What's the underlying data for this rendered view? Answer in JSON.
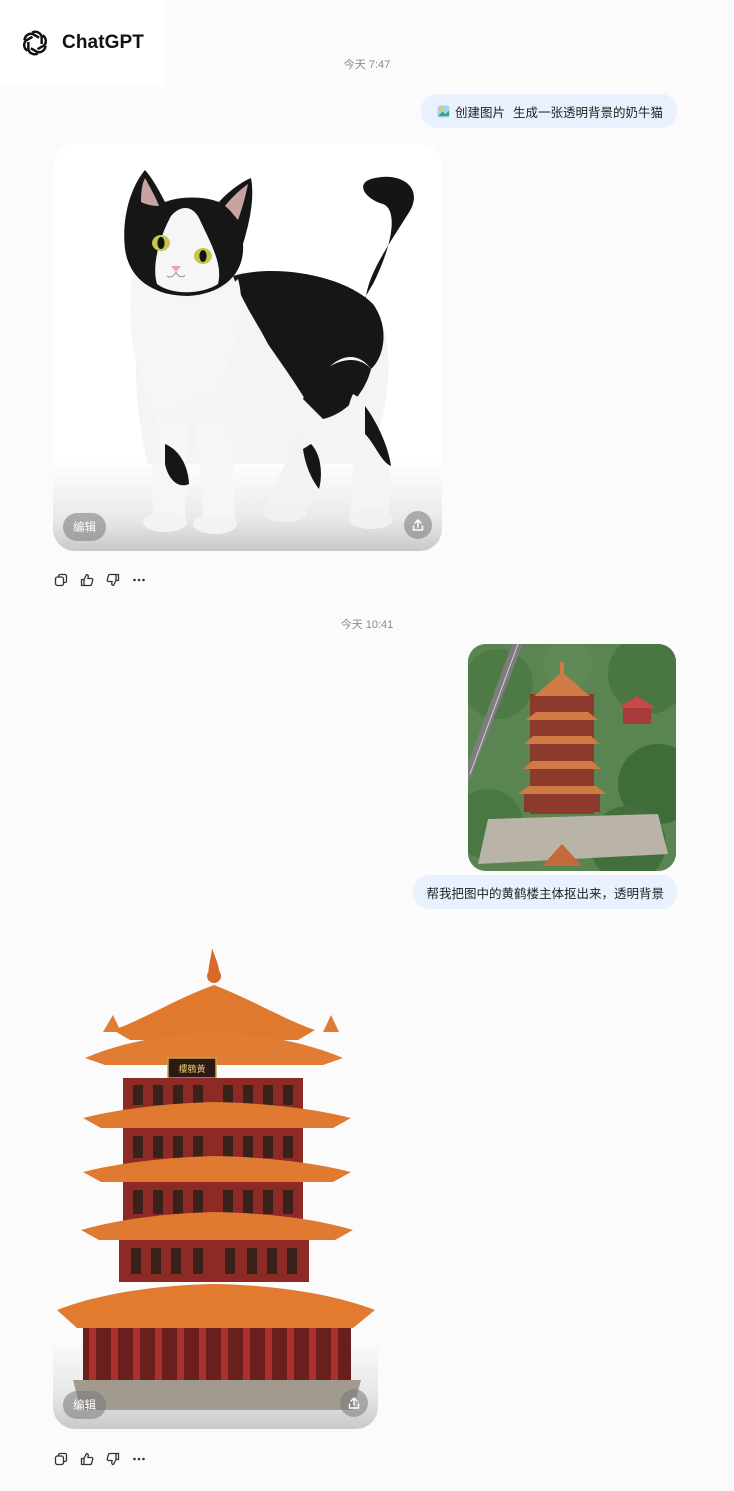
{
  "brand": {
    "name": "ChatGPT",
    "icon": "openai-logo-icon"
  },
  "conversation": {
    "turns": [
      {
        "timestamp": "今天 7:47",
        "user": {
          "tool_icon": "image-create-icon",
          "tool_label": "创建图片",
          "text": "生成一张透明背景的奶牛猫"
        },
        "assistant": {
          "image": "tuxedo-cat-transparent-image",
          "edit_label": "编辑",
          "share_icon": "share-icon",
          "actions": [
            "copy-icon",
            "thumbs-up-icon",
            "thumbs-down-icon",
            "more-icon"
          ]
        }
      },
      {
        "timestamp": "今天 10:41",
        "user": {
          "attachment": "yellow-crane-tower-photo",
          "text": "帮我把图中的黄鹤楼主体抠出来，透明背景"
        },
        "assistant": {
          "image": "yellow-crane-tower-cutout-image",
          "sign_text": "樓鶴黃",
          "edit_label": "编辑",
          "share_icon": "share-icon",
          "actions": [
            "copy-icon",
            "thumbs-up-icon",
            "thumbs-down-icon",
            "more-icon"
          ]
        }
      }
    ]
  },
  "colors": {
    "background": "#fbfbfb",
    "user_bubble": "#e8f1fd",
    "timestamp": "#8a8a8a",
    "roof_orange": "#e0782e",
    "pillar_red": "#8d2a26"
  }
}
